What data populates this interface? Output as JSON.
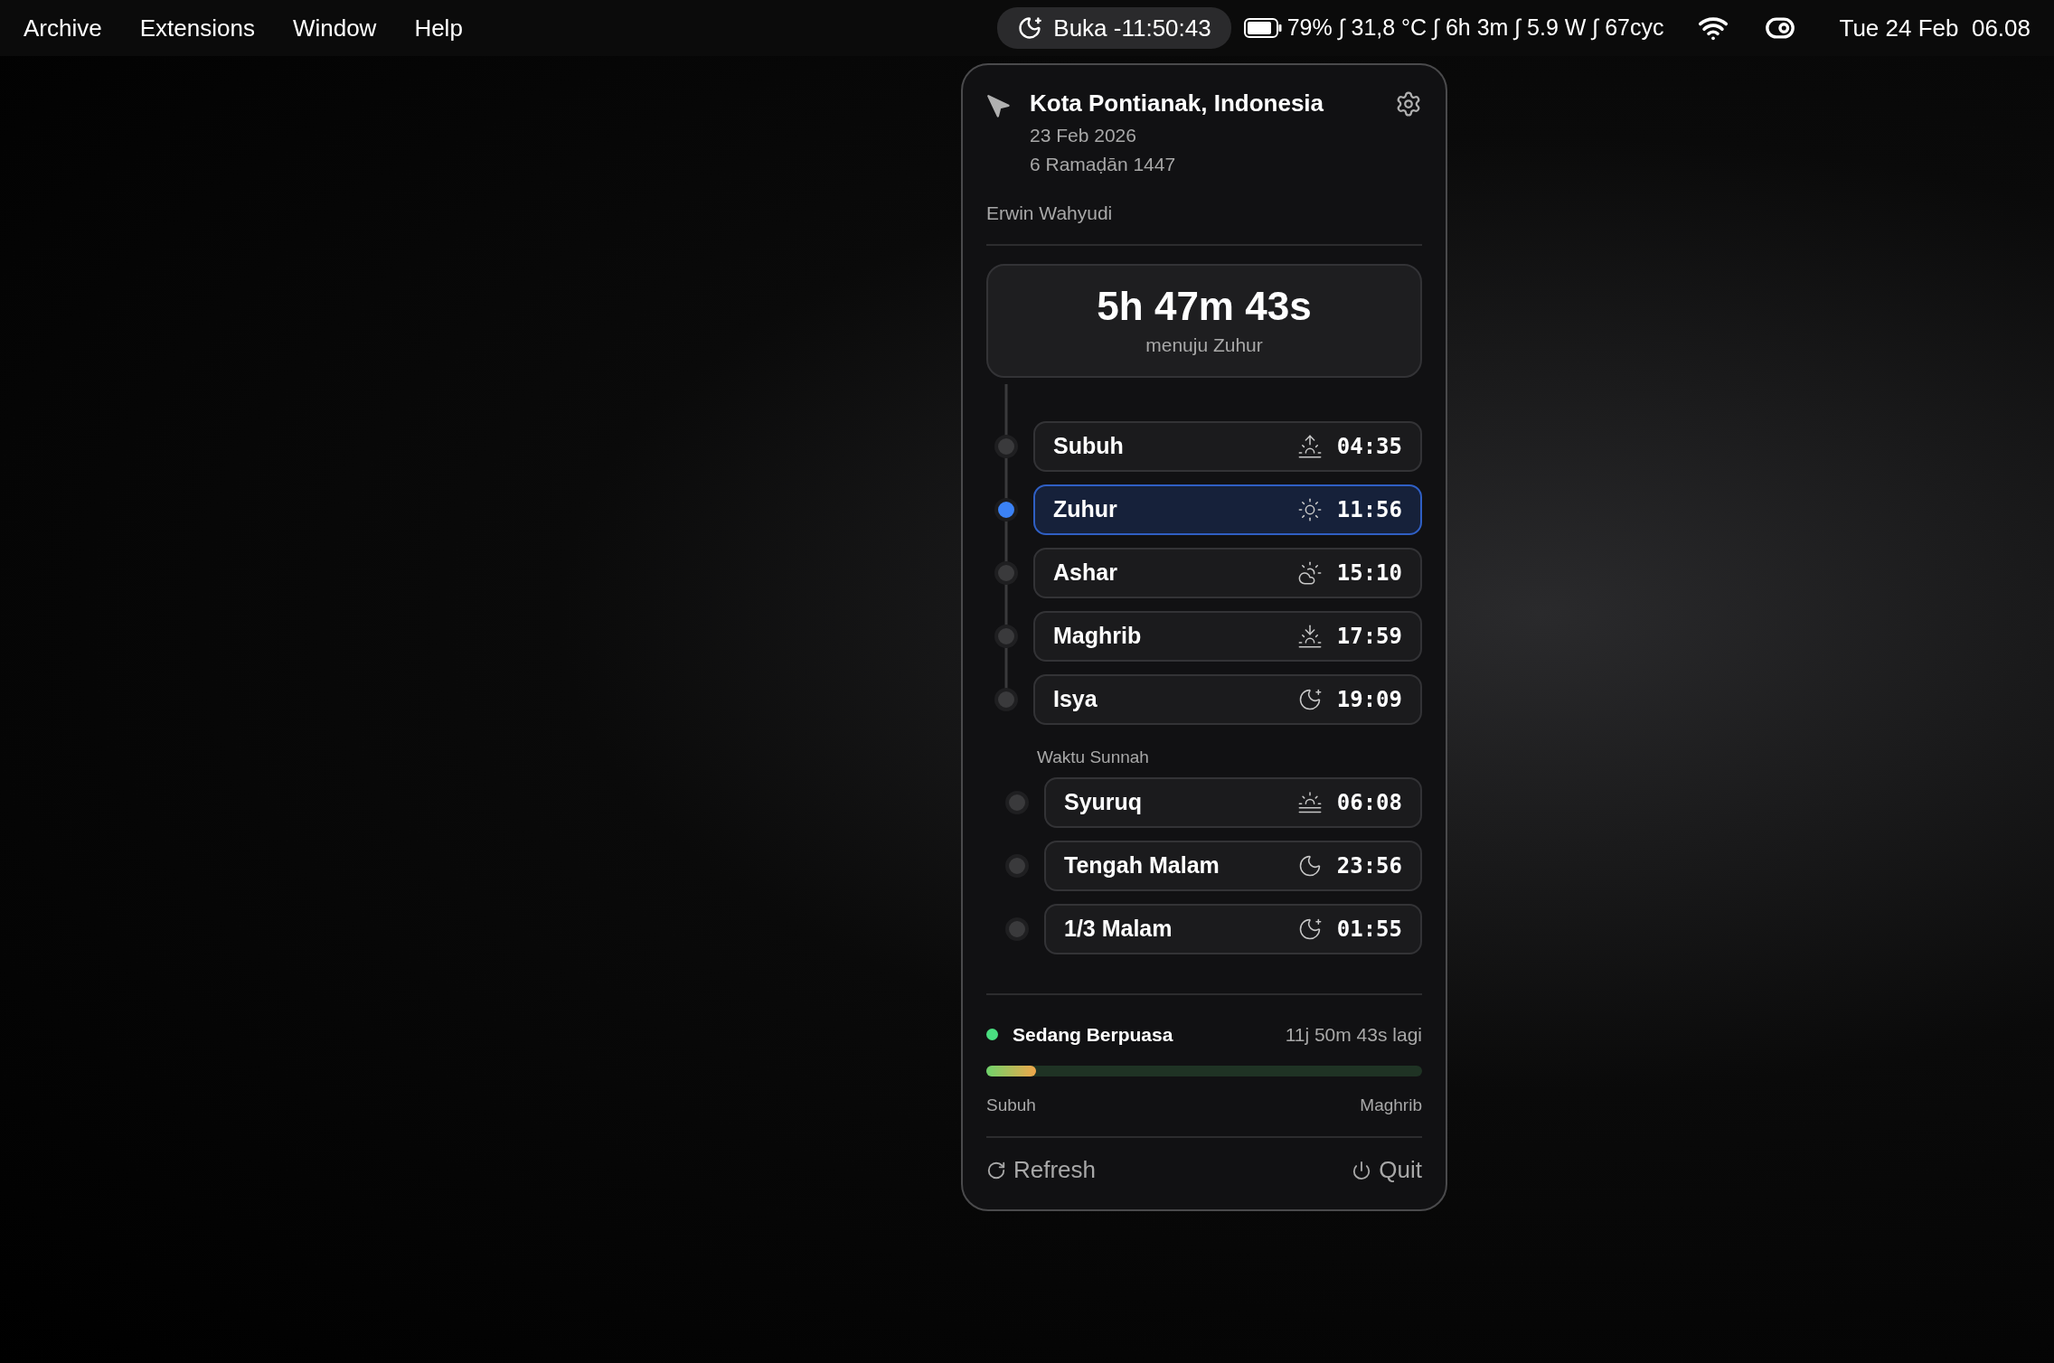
{
  "menu_bar": {
    "app_menus": [
      "Archive",
      "Extensions",
      "Window",
      "Help"
    ],
    "status_pill": "Buka -11:50:43",
    "status_text": "79% ∫ 31,8 °C ∫ 6h 3m ∫ 5.9 W ∫ 67cyc",
    "clock": "Tue 24 Feb  06.08"
  },
  "popup": {
    "location": "Kota Pontianak, Indonesia",
    "gregorian_date": "23 Feb 2026",
    "hijri_date": "6 Ramaḍān 1447",
    "user": "Erwin Wahyudi",
    "countdown": {
      "time": "5h 47m 43s",
      "label": "menuju Zuhur"
    },
    "prayers": [
      {
        "name": "Subuh",
        "kind": "dawn",
        "time": "04:35",
        "selected": false
      },
      {
        "name": "Zuhur",
        "kind": "sun",
        "time": "11:56",
        "selected": true
      },
      {
        "name": "Ashar",
        "kind": "cloud-sun",
        "time": "15:10",
        "selected": false
      },
      {
        "name": "Maghrib",
        "kind": "sunset",
        "time": "17:59",
        "selected": false
      },
      {
        "name": "Isya",
        "kind": "moon-star",
        "time": "19:09",
        "selected": false
      }
    ],
    "sunnah": {
      "title": "Waktu Sunnah",
      "items": [
        {
          "name": "Syuruq",
          "kind": "haze",
          "time": "06:08",
          "selected": false
        },
        {
          "name": "Tengah Malam",
          "kind": "moon",
          "time": "23:56",
          "selected": false
        },
        {
          "name": "1/3 Malam",
          "kind": "moon-star",
          "time": "01:55",
          "selected": false
        }
      ]
    },
    "fasting": {
      "status": "Sedang Berpuasa",
      "remaining": "11j 50m 43s lagi",
      "level": 0.115,
      "start_label": "Subuh",
      "end_label": "Maghrib"
    },
    "actions": [
      {
        "label": "Refresh",
        "kind": "refresh"
      },
      {
        "label": "Quit",
        "kind": "quit"
      }
    ]
  }
}
